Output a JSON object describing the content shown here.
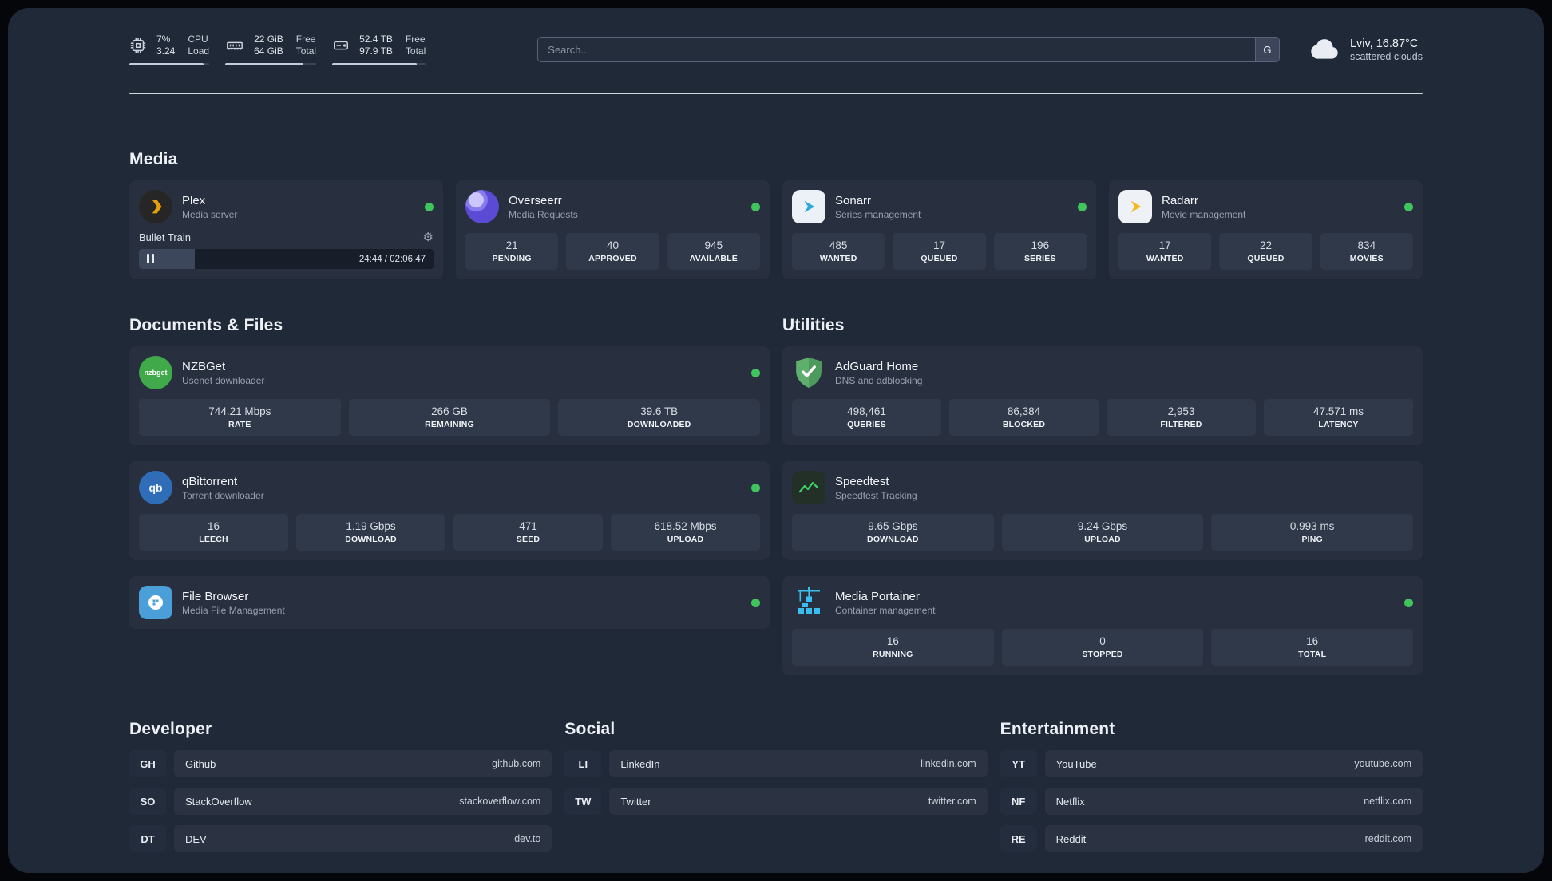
{
  "theme": {
    "panel_bg": "#202937",
    "card_bg": "#28303f",
    "tile_bg": "#2f3949",
    "status_online": "#3fc45e"
  },
  "topbar": {
    "metrics": {
      "cpu": {
        "icon": "cpu-icon",
        "value_top": "7%",
        "value_bottom": "3.24",
        "label_top": "CPU",
        "label_bottom": "Load"
      },
      "memory": {
        "icon": "memory-icon",
        "value_top": "22 GiB",
        "value_bottom": "64 GiB",
        "label_top": "Free",
        "label_bottom": "Total"
      },
      "disk": {
        "icon": "disk-icon",
        "value_top": "52.4 TB",
        "value_bottom": "97.9 TB",
        "label_top": "Free",
        "label_bottom": "Total"
      }
    },
    "search": {
      "placeholder": "Search...",
      "engine_button": "G"
    },
    "weather": {
      "icon": "cloud-icon",
      "location": "Lviv, 16.87°C",
      "condition": "scattered clouds"
    }
  },
  "sections": {
    "media": {
      "title": "Media",
      "cards": [
        {
          "icon": "plex-icon",
          "title": "Plex",
          "subtitle": "Media server",
          "status": "online",
          "player": {
            "track": "Bullet Train",
            "time": "24:44 / 02:06:47"
          }
        },
        {
          "icon": "overseerr-icon",
          "title": "Overseerr",
          "subtitle": "Media Requests",
          "status": "online",
          "stats": [
            {
              "value": "21",
              "label": "PENDING"
            },
            {
              "value": "40",
              "label": "APPROVED"
            },
            {
              "value": "945",
              "label": "AVAILABLE"
            }
          ]
        },
        {
          "icon": "sonarr-icon",
          "title": "Sonarr",
          "subtitle": "Series management",
          "status": "online",
          "stats": [
            {
              "value": "485",
              "label": "WANTED"
            },
            {
              "value": "17",
              "label": "QUEUED"
            },
            {
              "value": "196",
              "label": "SERIES"
            }
          ]
        },
        {
          "icon": "radarr-icon",
          "title": "Radarr",
          "subtitle": "Movie management",
          "status": "online",
          "stats": [
            {
              "value": "17",
              "label": "WANTED"
            },
            {
              "value": "22",
              "label": "QUEUED"
            },
            {
              "value": "834",
              "label": "MOVIES"
            }
          ]
        }
      ]
    },
    "documents": {
      "title": "Documents & Files",
      "cards": [
        {
          "icon": "nzbget-icon",
          "icon_text": "nzbget",
          "title": "NZBGet",
          "subtitle": "Usenet downloader",
          "status": "online",
          "stats": [
            {
              "value": "744.21 Mbps",
              "label": "RATE"
            },
            {
              "value": "266 GB",
              "label": "REMAINING"
            },
            {
              "value": "39.6 TB",
              "label": "DOWNLOADED"
            }
          ]
        },
        {
          "icon": "qbittorrent-icon",
          "icon_text": "qb",
          "title": "qBittorrent",
          "subtitle": "Torrent downloader",
          "status": "online",
          "stats": [
            {
              "value": "16",
              "label": "LEECH"
            },
            {
              "value": "1.19 Gbps",
              "label": "DOWNLOAD"
            },
            {
              "value": "471",
              "label": "SEED"
            },
            {
              "value": "618.52 Mbps",
              "label": "UPLOAD"
            }
          ]
        },
        {
          "icon": "filebrowser-icon",
          "title": "File Browser",
          "subtitle": "Media File Management",
          "status": "online"
        }
      ]
    },
    "utilities": {
      "title": "Utilities",
      "cards": [
        {
          "icon": "adguard-icon",
          "title": "AdGuard Home",
          "subtitle": "DNS and adblocking",
          "stats": [
            {
              "value": "498,461",
              "label": "QUERIES"
            },
            {
              "value": "86,384",
              "label": "BLOCKED"
            },
            {
              "value": "2,953",
              "label": "FILTERED"
            },
            {
              "value": "47.571 ms",
              "label": "LATENCY"
            }
          ]
        },
        {
          "icon": "speedtest-icon",
          "title": "Speedtest",
          "subtitle": "Speedtest Tracking",
          "stats": [
            {
              "value": "9.65 Gbps",
              "label": "DOWNLOAD"
            },
            {
              "value": "9.24 Gbps",
              "label": "UPLOAD"
            },
            {
              "value": "0.993 ms",
              "label": "PING"
            }
          ]
        },
        {
          "icon": "portainer-icon",
          "title": "Media Portainer",
          "subtitle": "Container management",
          "status": "online",
          "stats": [
            {
              "value": "16",
              "label": "RUNNING"
            },
            {
              "value": "0",
              "label": "STOPPED"
            },
            {
              "value": "16",
              "label": "TOTAL"
            }
          ]
        }
      ]
    }
  },
  "bookmarks": {
    "developer": {
      "title": "Developer",
      "items": [
        {
          "abbr": "GH",
          "name": "Github",
          "url": "github.com"
        },
        {
          "abbr": "SO",
          "name": "StackOverflow",
          "url": "stackoverflow.com"
        },
        {
          "abbr": "DT",
          "name": "DEV",
          "url": "dev.to"
        }
      ]
    },
    "social": {
      "title": "Social",
      "items": [
        {
          "abbr": "LI",
          "name": "LinkedIn",
          "url": "linkedin.com"
        },
        {
          "abbr": "TW",
          "name": "Twitter",
          "url": "twitter.com"
        }
      ]
    },
    "entertainment": {
      "title": "Entertainment",
      "items": [
        {
          "abbr": "YT",
          "name": "YouTube",
          "url": "youtube.com"
        },
        {
          "abbr": "NF",
          "name": "Netflix",
          "url": "netflix.com"
        },
        {
          "abbr": "RE",
          "name": "Reddit",
          "url": "reddit.com"
        }
      ]
    }
  }
}
